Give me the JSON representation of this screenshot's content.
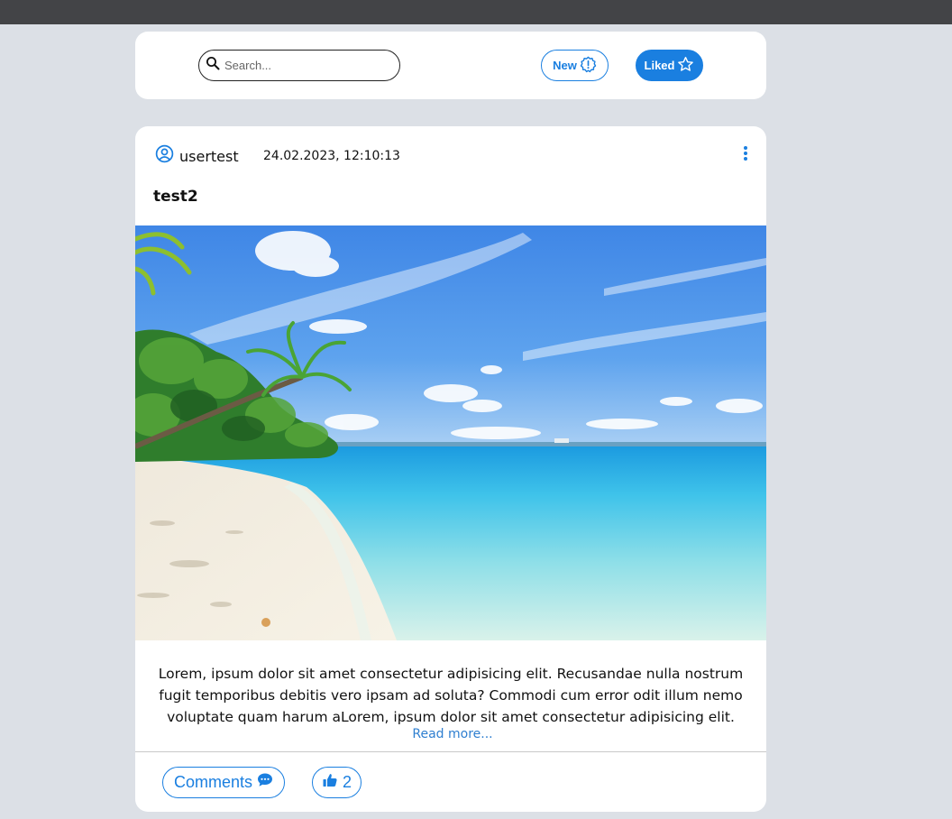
{
  "header": {
    "search_placeholder": "Search...",
    "new_label": "New",
    "liked_label": "Liked"
  },
  "post": {
    "username": "usertest",
    "timestamp": "24.02.2023, 12:10:13",
    "title": "test2",
    "body": "Lorem, ipsum dolor sit amet consectetur adipisicing elit. Recusandae nulla nostrum fugit temporibus debitis vero ipsam ad soluta? Commodi cum error odit illum nemo voluptate quam harum aLorem, ipsum dolor sit amet consectetur adipisicing elit. Recusandae nulla nostrum fugit temporibus debitis vero ipsam ad soluta?",
    "read_more": "Read more...",
    "comments_label": "Comments",
    "likes_count": "2"
  },
  "colors": {
    "accent": "#1a7fe0",
    "page_background": "#dce0e6",
    "topbar": "#434447"
  },
  "icons": {
    "search": "search-icon",
    "new": "new-badge-icon",
    "liked": "star-icon",
    "user": "user-circle-icon",
    "menu": "kebab-menu-icon",
    "comments": "chat-bubble-icon",
    "like": "thumbs-up-icon"
  }
}
